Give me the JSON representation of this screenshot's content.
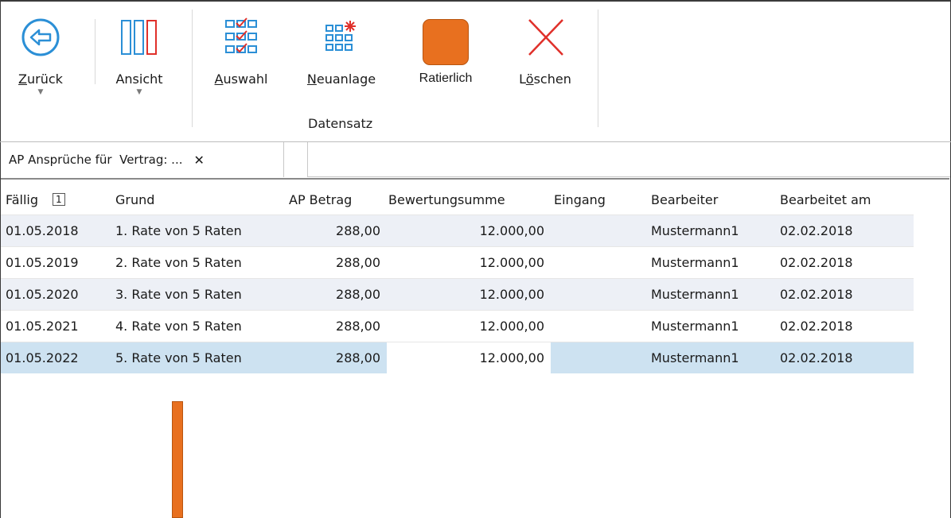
{
  "ribbon": {
    "buttons": [
      {
        "label": "Zurück",
        "access_key_index": 0,
        "icon": "back-arrow-icon",
        "has_dropdown": true
      },
      {
        "label": "Ansicht",
        "icon": "columns-icon",
        "has_dropdown": true
      },
      {
        "label": "Auswahl",
        "access_key_index": 0,
        "icon": "checklist-icon"
      },
      {
        "label": "Neuanlage",
        "access_key_index": 0,
        "icon": "new-record-icon"
      },
      {
        "label": "Ratierlich",
        "icon": "orange-square-icon"
      },
      {
        "label": "Löschen",
        "access_key_index": 1,
        "icon": "delete-x-icon"
      }
    ],
    "group_label": "Datensatz"
  },
  "tab": {
    "title": "AP Ansprüche für  Vertrag: ...",
    "close": "✕"
  },
  "grid": {
    "columns": [
      "Fällig",
      "Grund",
      "AP Betrag",
      "Bewertungsumme",
      "Eingang",
      "Bearbeiter",
      "Bearbeitet am"
    ],
    "sort_indicator": "1",
    "rows": [
      [
        "01.05.2018",
        "1. Rate von 5 Raten",
        "288,00",
        "12.000,00",
        "",
        "Mustermann1",
        "02.02.2018"
      ],
      [
        "01.05.2019",
        "2. Rate von 5 Raten",
        "288,00",
        "12.000,00",
        "",
        "Mustermann1",
        "02.02.2018"
      ],
      [
        "01.05.2020",
        "3. Rate von 5 Raten",
        "288,00",
        "12.000,00",
        "",
        "Mustermann1",
        "02.02.2018"
      ],
      [
        "01.05.2021",
        "4. Rate von 5 Raten",
        "288,00",
        "12.000,00",
        "",
        "Mustermann1",
        "02.02.2018"
      ],
      [
        "01.05.2022",
        "5. Rate von 5 Raten",
        "288,00",
        "12.000,00",
        "",
        "Mustermann1",
        "02.02.2018"
      ]
    ],
    "selected_row": 4
  },
  "colors": {
    "accent_orange": "#e8701f",
    "selection": "#cde2f1",
    "alt_row": "#edf0f6",
    "icon_blue": "#2b8fd6",
    "icon_red": "#e0302a"
  }
}
